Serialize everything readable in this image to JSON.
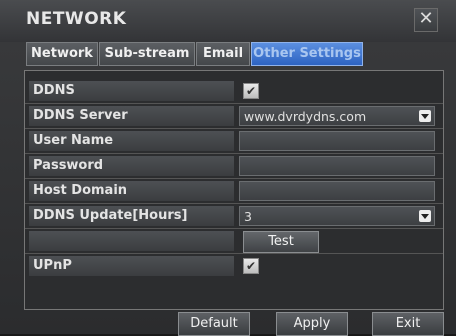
{
  "window": {
    "title": "NETWORK",
    "close_label": "✕"
  },
  "tabs": [
    {
      "label": "Network",
      "active": false
    },
    {
      "label": "Sub-stream",
      "active": false
    },
    {
      "label": "Email",
      "active": false
    },
    {
      "label": "Other Settings",
      "active": true
    }
  ],
  "rows": {
    "ddns": {
      "label": "DDNS",
      "checked": true,
      "check_glyph": "✔"
    },
    "ddns_server": {
      "label": "DDNS Server",
      "value": "www.dvrdydns.com"
    },
    "user_name": {
      "label": "User Name",
      "value": ""
    },
    "password": {
      "label": "Password",
      "value": ""
    },
    "host_domain": {
      "label": "Host Domain",
      "value": ""
    },
    "ddns_update": {
      "label": "DDNS Update[Hours]",
      "value": "3"
    },
    "test": {
      "label": "Test"
    },
    "upnp": {
      "label": "UPnP",
      "checked": true,
      "check_glyph": "✔"
    }
  },
  "buttons": {
    "default": "Default",
    "apply": "Apply",
    "exit": "Exit"
  }
}
